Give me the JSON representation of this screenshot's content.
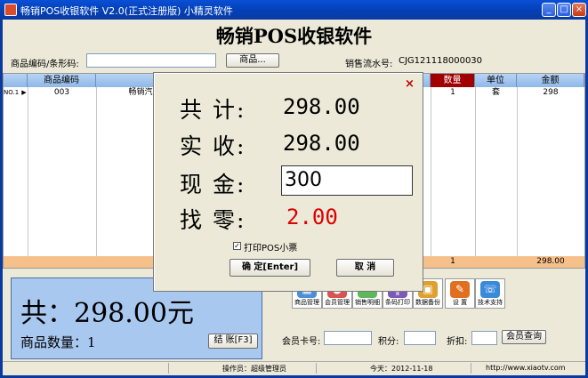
{
  "window": {
    "title": "畅销POS收银软件 V2.0(正式注册版) 小精灵软件",
    "controls": {
      "minimize": "_",
      "maximize": "□",
      "close": "×"
    }
  },
  "header": {
    "app_title": "畅销POS收银软件",
    "barcode_label": "商品编码/条形码:",
    "barcode_value": "",
    "product_button": "商品...",
    "serial_label": "销售流水号:",
    "serial_value": "CJG121118000030"
  },
  "table": {
    "columns": [
      "商品编码",
      "",
      "",
      "数量",
      "单位",
      "金额"
    ],
    "rows": [
      {
        "row_no": "NO.1",
        "marker": "▶",
        "code": "003",
        "name": "畅销汽",
        "qty": "1",
        "unit": "套",
        "amount": "298"
      }
    ],
    "totals": {
      "qty": "1",
      "amount": "298.00"
    }
  },
  "summary": {
    "total_text": "共：298.00元",
    "qty_text": "商品数量：1",
    "checkout_button": "结 账[F3]"
  },
  "toolbar": [
    {
      "label": "商品管理",
      "icon": "product-management-icon",
      "color": "#4a90d9"
    },
    {
      "label": "会员管理",
      "icon": "member-management-icon",
      "color": "#d9534f"
    },
    {
      "label": "销售明细",
      "icon": "sales-detail-icon",
      "color": "#5cb85c"
    },
    {
      "label": "条码打印",
      "icon": "barcode-print-icon",
      "color": "#7a5cb8"
    },
    {
      "label": "数据备份",
      "icon": "data-backup-icon",
      "color": "#e0a030"
    },
    {
      "label": "设 置",
      "icon": "settings-icon",
      "color": "#e07020"
    },
    {
      "label": "技术支持",
      "icon": "tech-support-icon",
      "color": "#3a8ad9"
    }
  ],
  "member": {
    "card_label": "会员卡号:",
    "card_value": "",
    "points_label": "积分:",
    "points_value": "",
    "discount_label": "折扣:",
    "discount_value": "",
    "query_button": "会员查询"
  },
  "statusbar": {
    "operator": "操作员：超级管理员",
    "date": "今天：2012-11-18",
    "website": "http://www.xiaotv.com"
  },
  "dialog": {
    "close": "×",
    "total_label": "共 计:",
    "total_value": "298.00",
    "received_label": "实 收:",
    "received_value": "298.00",
    "cash_label": "现 金:",
    "cash_value": "300",
    "change_label": "找 零:",
    "change_value": "2.00",
    "change_color": "#dd0000",
    "print_label": "打印POS小票",
    "print_checked": true,
    "confirm_button": "确 定[Enter]",
    "cancel_button": "取 消"
  }
}
